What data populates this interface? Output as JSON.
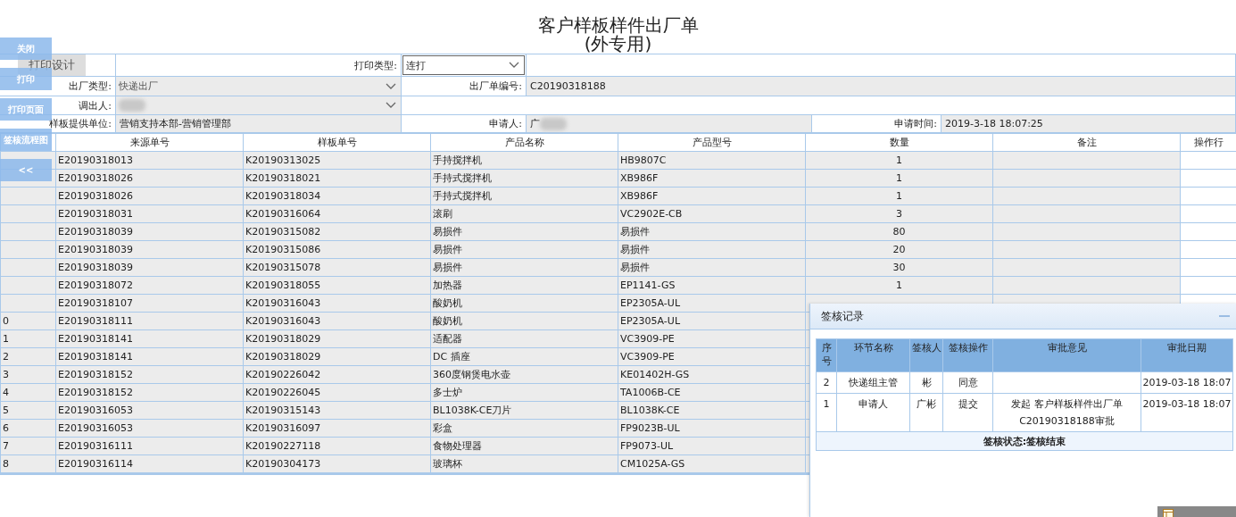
{
  "title": {
    "lines": [
      "客户样板样件出厂单",
      "(外专用)"
    ]
  },
  "sidebar": {
    "buttons": [
      "关闭",
      "打印",
      "打印页面",
      "签核流程图",
      "<<"
    ]
  },
  "form": {
    "print_design_button": "打印设计",
    "print_type": {
      "label": "打印类型:",
      "value": "连打"
    },
    "ship_type": {
      "label": "出厂类型:",
      "value": "快递出厂",
      "disabled": true
    },
    "order_no": {
      "label": "出厂单编号:",
      "value": "C20190318188"
    },
    "dispatcher": {
      "label": "调出人:"
    },
    "provider": {
      "label": "样板提供单位:",
      "value": "营销支持本部-营销管理部"
    },
    "applicant": {
      "label": "申请人:",
      "value": "广"
    },
    "apply_time": {
      "label": "申请时间:",
      "value": "2019-3-18 18:07:25"
    }
  },
  "table": {
    "columns": [
      "来源单号",
      "样板单号",
      "产品名称",
      "产品型号",
      "数量",
      "备注",
      "操作行"
    ],
    "rows": [
      {
        "source": "E20190318013",
        "sample": "K20190313025",
        "name": "手持搅拌机",
        "model": "HB9807C",
        "qty": "1"
      },
      {
        "source": "E20190318026",
        "sample": "K20190318021",
        "name": "手持式搅拌机",
        "model": "XB986F",
        "qty": "1"
      },
      {
        "source": "E20190318026",
        "sample": "K20190318034",
        "name": "手持式搅拌机",
        "model": "XB986F",
        "qty": "1"
      },
      {
        "source": "E20190318031",
        "sample": "K20190316064",
        "name": "滚刷",
        "model": "VC2902E-CB",
        "qty": "3"
      },
      {
        "source": "E20190318039",
        "sample": "K20190315082",
        "name": "易损件",
        "model": "易损件",
        "qty": "80"
      },
      {
        "source": "E20190318039",
        "sample": "K20190315086",
        "name": "易损件",
        "model": "易损件",
        "qty": "20"
      },
      {
        "source": "E20190318039",
        "sample": "K20190315078",
        "name": "易损件",
        "model": "易损件",
        "qty": "30"
      },
      {
        "source": "E20190318072",
        "sample": "K20190318055",
        "name": "加热器",
        "model": "EP1141-GS",
        "qty": "1"
      },
      {
        "source": "E20190318107",
        "sample": "K20190316043",
        "name": "酸奶机",
        "model": "EP2305A-UL"
      },
      {
        "seq": "0",
        "source": "E20190318111",
        "sample": "K20190316043",
        "name": "酸奶机",
        "model": "EP2305A-UL"
      },
      {
        "seq": "1",
        "source": "E20190318141",
        "sample": "K20190318029",
        "name": "适配器",
        "model": "VC3909-PE"
      },
      {
        "seq": "2",
        "source": "E20190318141",
        "sample": "K20190318029",
        "name": "DC 插座",
        "model": "VC3909-PE"
      },
      {
        "seq": "3",
        "source": "E20190318152",
        "sample": "K20190226042",
        "name": "360度钢煲电水壶",
        "model": "KE01402H-GS"
      },
      {
        "seq": "4",
        "source": "E20190318152",
        "sample": "K20190226045",
        "name": "多士炉",
        "model": "TA1006B-CE"
      },
      {
        "seq": "5",
        "source": "E20190316053",
        "sample": "K20190315143",
        "name": "BL1038K-CE刀片",
        "model": "BL1038K-CE"
      },
      {
        "seq": "6",
        "source": "E20190316053",
        "sample": "K20190316097",
        "name": "彩盒",
        "model": "FP9023B-UL"
      },
      {
        "seq": "7",
        "source": "E20190316111",
        "sample": "K20190227118",
        "name": "食物处理器",
        "model": "FP9073-UL"
      },
      {
        "seq": "8",
        "source": "E20190316114",
        "sample": "K20190304173",
        "name": "玻璃杯",
        "model": "CM1025A-GS"
      }
    ]
  },
  "approval_panel": {
    "title": "签核记录",
    "columns": [
      "序号",
      "环节名称",
      "签核人",
      "签核操作",
      "审批意见",
      "审批日期"
    ],
    "rows": [
      {
        "seq": "2",
        "step": "快递组主管",
        "approver": "彬",
        "action": "同意",
        "date": "2019-03-18 18:07"
      },
      {
        "seq": "1",
        "step": "申请人",
        "approver": "广彬",
        "action": "提交",
        "comment": "发起 客户样板样件出厂单 C20190318188审批",
        "date": "2019-03-18 18:07"
      }
    ],
    "status": "签核状态:签核结束"
  }
}
